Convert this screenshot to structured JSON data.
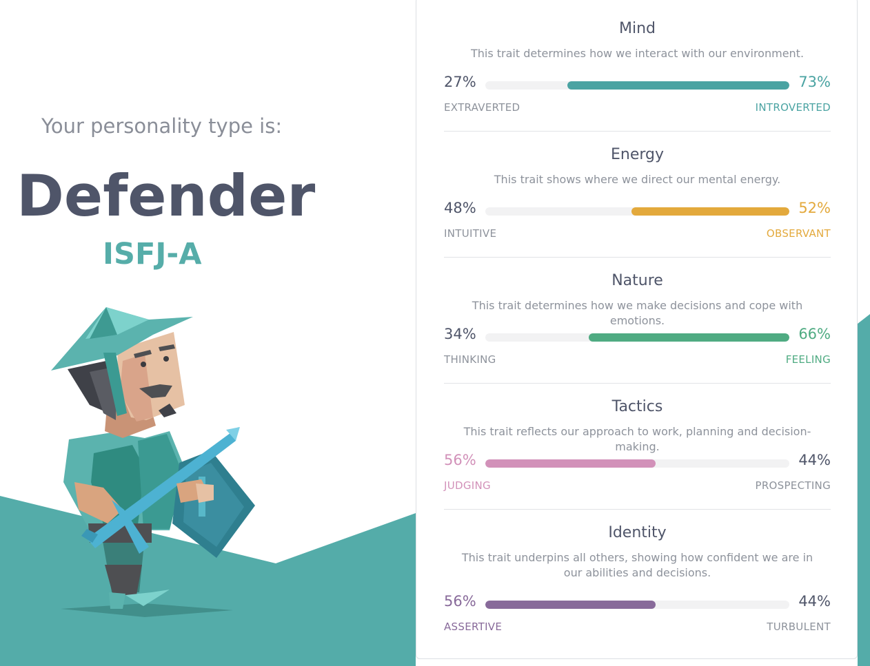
{
  "intro_text": "Your personality type is:",
  "type_name": "Defender",
  "type_code": "ISFJ-A",
  "colors": {
    "teal_bg": "#54aca9",
    "title": "#4f5569",
    "code": "#56ada9"
  },
  "traits": [
    {
      "title": "Mind",
      "description": "This trait determines how we interact with our environment.",
      "left_percent": "27%",
      "right_percent": "73%",
      "left_label": "EXTRAVERTED",
      "right_label": "INTROVERTED",
      "dominant": "right",
      "fraction": 0.73,
      "color": "#4aa3a2"
    },
    {
      "title": "Energy",
      "description": "This trait shows where we direct our mental energy.",
      "left_percent": "48%",
      "right_percent": "52%",
      "left_label": "INTUITIVE",
      "right_label": "OBSERVANT",
      "dominant": "right",
      "fraction": 0.52,
      "color": "#e3a93c"
    },
    {
      "title": "Nature",
      "description": "This trait determines how we make decisions and cope with emotions.",
      "left_percent": "34%",
      "right_percent": "66%",
      "left_label": "THINKING",
      "right_label": "FEELING",
      "dominant": "right",
      "fraction": 0.66,
      "color": "#4fab82"
    },
    {
      "title": "Tactics",
      "description": "This trait reflects our approach to work, planning and decision-making.",
      "left_percent": "56%",
      "right_percent": "44%",
      "left_label": "JUDGING",
      "right_label": "PROSPECTING",
      "dominant": "left",
      "fraction": 0.56,
      "color": "#d291b9"
    },
    {
      "title": "Identity",
      "description": "This trait underpins all others, showing how confident we are in our abilities and decisions.",
      "left_percent": "56%",
      "right_percent": "44%",
      "left_label": "ASSERTIVE",
      "right_label": "TURBULENT",
      "dominant": "left",
      "fraction": 0.56,
      "color": "#886a9a"
    }
  ]
}
